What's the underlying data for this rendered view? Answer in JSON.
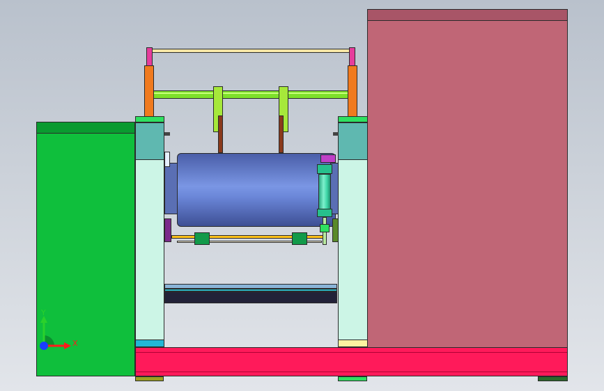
{
  "viewport": {
    "triad": {
      "x_label": "X",
      "y_label": "Y",
      "x_color": "#ff1a1a",
      "y_color": "#2bd12b",
      "z_color": "#1a3cff"
    }
  },
  "colors": {
    "background_top": "#b9c1cc",
    "left_housing": "#0fbf3c",
    "right_housing": "#c06676",
    "base_rail": "#ff1a5a",
    "side_plate": "#ccf5e6",
    "plate_top": "#5fb8b0",
    "drum": "#6a86d8",
    "upper_shaft": "#7ee02a",
    "bracket": "#f07a1e",
    "cylinder": "#3fd6a8"
  }
}
